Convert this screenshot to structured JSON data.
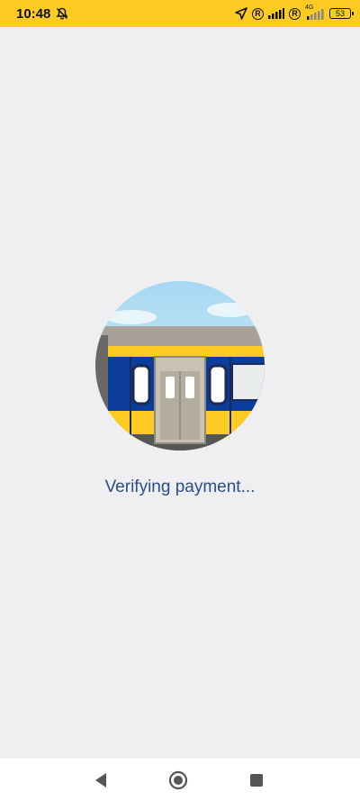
{
  "status_bar": {
    "time": "10:48",
    "battery": "53",
    "network": "4G",
    "icons": [
      "bell-off-icon",
      "location-arrow-icon",
      "registered-icon",
      "signal-icon",
      "registered-icon",
      "signal-4g-icon",
      "battery-icon"
    ],
    "background": "#fecb23"
  },
  "main": {
    "illustration": "train-door-illustration",
    "message": "Verifying payment..."
  },
  "nav_bar": {
    "icons": [
      "back-icon",
      "home-icon",
      "recents-icon"
    ]
  },
  "colors": {
    "message_text": "#2a4f86",
    "train_yellow": "#fecb23",
    "train_blue": "#0a3d9c"
  }
}
